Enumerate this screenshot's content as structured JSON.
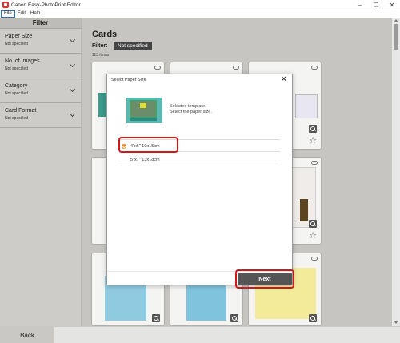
{
  "window": {
    "title": "Canon Easy-PhotoPrint Editor",
    "controls": [
      "–",
      "☐",
      "✕"
    ]
  },
  "menu": [
    "File",
    "Edit",
    "Help"
  ],
  "sidebar": {
    "header": "Filter",
    "items": [
      {
        "name": "Paper Size",
        "value": "Not specified"
      },
      {
        "name": "No. of Images",
        "value": "Not specified"
      },
      {
        "name": "Category",
        "value": "Not specified"
      },
      {
        "name": "Card Format",
        "value": "Not specified"
      }
    ]
  },
  "main": {
    "title": "Cards",
    "filter_label": "Filter:",
    "filter_value": "Not specified",
    "item_count": "113 items"
  },
  "dialog": {
    "title": "Select Paper Size",
    "close": "✕",
    "selected_label": "Selected template.\nSelect the paper size.",
    "options": [
      "4\"x6\" 10x15cm",
      "5\"x7\" 13x18cm"
    ],
    "selected_option": "4\"x6\" 10x15cm",
    "next_label": "Next",
    "highlight_color": "#d01818"
  },
  "footer": {
    "back_label": "Back"
  },
  "colors": {
    "accent_check": "#e08a1e",
    "next_button": "#555555",
    "template_teal": "#5bb8b0"
  }
}
